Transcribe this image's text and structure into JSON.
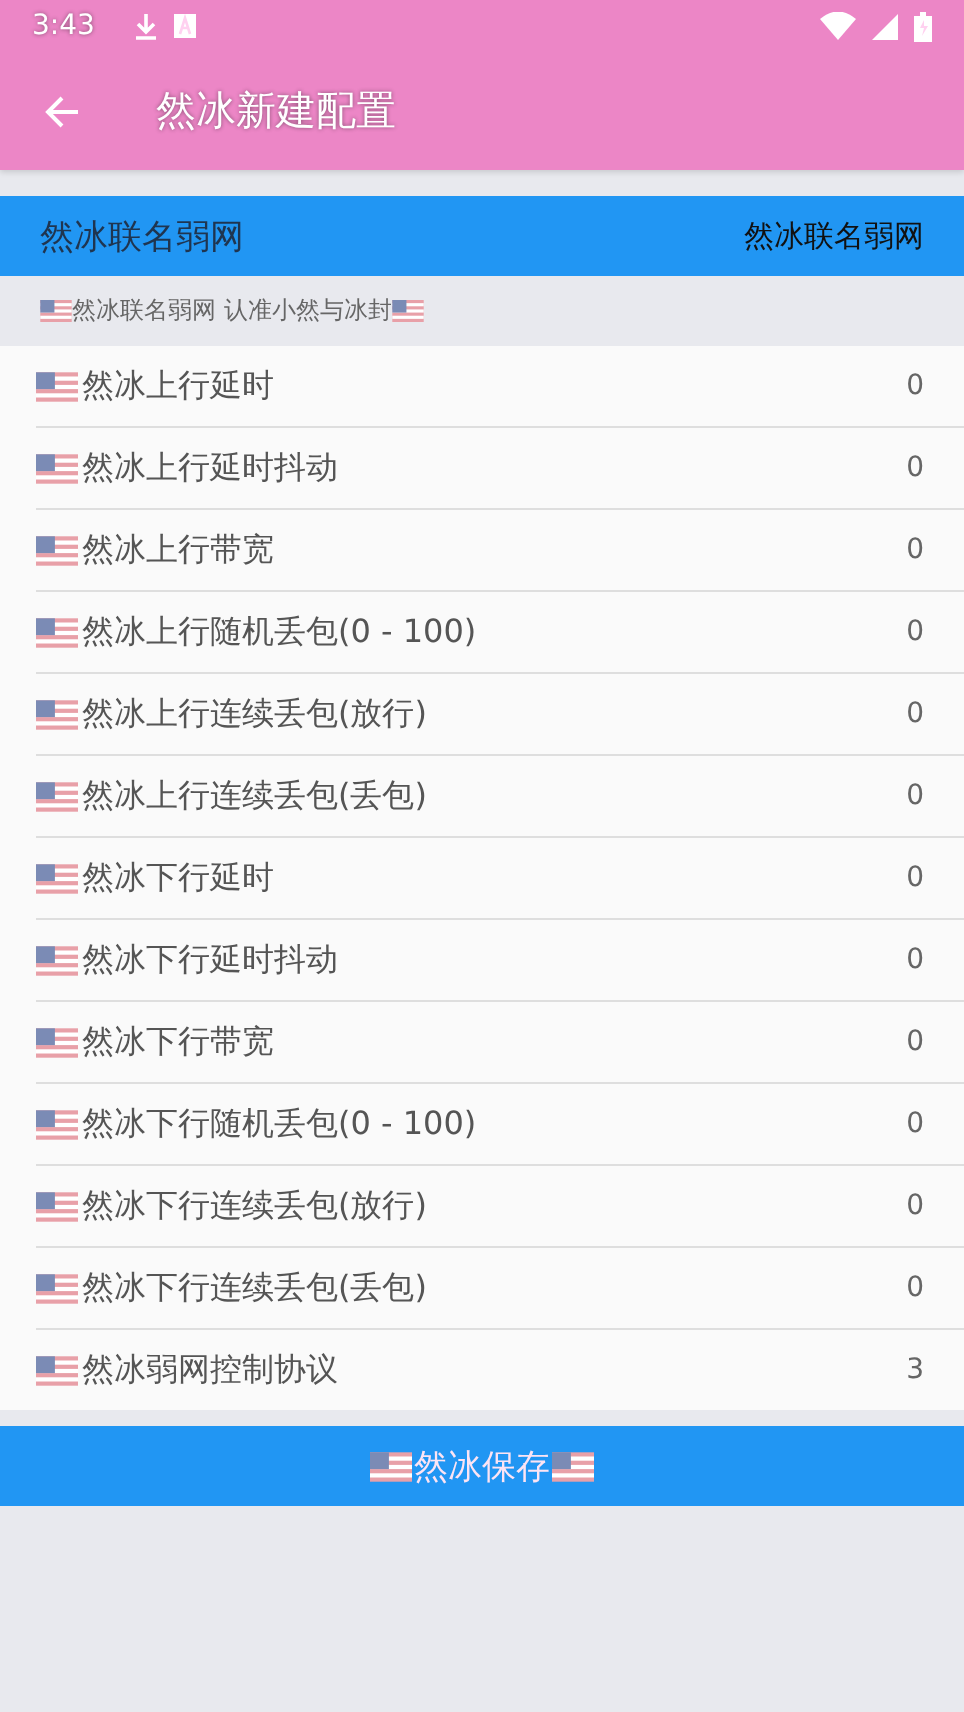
{
  "status_bar": {
    "time": "3:43"
  },
  "toolbar": {
    "title": "然冰新建配置"
  },
  "header": {
    "title": "然冰联名弱网",
    "value": "然冰联名弱网"
  },
  "subtitle": "然冰联名弱网 认准小然与冰封",
  "settings": [
    {
      "label": "然冰上行延时",
      "value": "0"
    },
    {
      "label": "然冰上行延时抖动",
      "value": "0"
    },
    {
      "label": "然冰上行带宽",
      "value": "0"
    },
    {
      "label": "然冰上行随机丢包(0 - 100)",
      "value": "0"
    },
    {
      "label": "然冰上行连续丢包(放行)",
      "value": "0"
    },
    {
      "label": "然冰上行连续丢包(丢包)",
      "value": "0"
    },
    {
      "label": "然冰下行延时",
      "value": "0"
    },
    {
      "label": "然冰下行延时抖动",
      "value": "0"
    },
    {
      "label": "然冰下行带宽",
      "value": "0"
    },
    {
      "label": "然冰下行随机丢包(0 - 100)",
      "value": "0"
    },
    {
      "label": "然冰下行连续丢包(放行)",
      "value": "0"
    },
    {
      "label": "然冰下行连续丢包(丢包)",
      "value": "0"
    },
    {
      "label": "然冰弱网控制协议",
      "value": "3"
    }
  ],
  "save_button": "然冰保存"
}
